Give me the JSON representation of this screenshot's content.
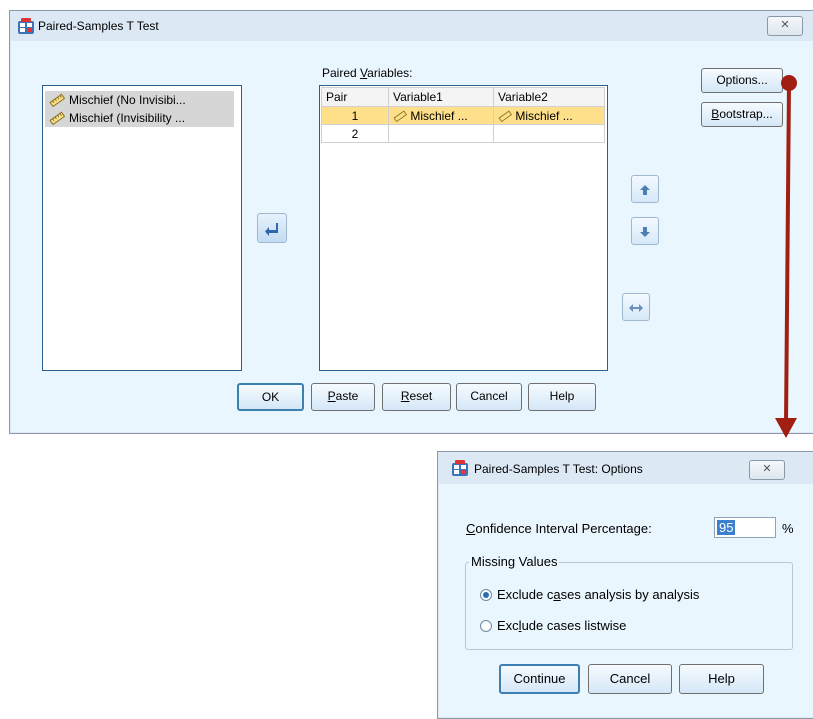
{
  "main_dialog": {
    "title": "Paired-Samples T Test",
    "close_glyph": "✕",
    "source_list": [
      "Mischief (No Invisibi...",
      "Mischief (Invisibility ..."
    ],
    "paired_label_pre": "Paired ",
    "paired_label_ul": "V",
    "paired_label_post": "ariables:",
    "table": {
      "headers": [
        "Pair",
        "Variable1",
        "Variable2"
      ],
      "rows": [
        {
          "pair": "1",
          "v1": "Mischief ...",
          "v2": "Mischief ..."
        },
        {
          "pair": "2",
          "v1": "",
          "v2": ""
        }
      ]
    },
    "options_button": "Options...",
    "bootstrap_ul": "B",
    "bootstrap_rest": "ootstrap...",
    "ok": "OK",
    "paste_ul": "P",
    "paste_rest": "aste",
    "reset_ul": "R",
    "reset_rest": "eset",
    "cancel": "Cancel",
    "help": "Help",
    "move_glyph": "➜",
    "up_glyph": "🡡",
    "down_glyph": "🡣",
    "swap_glyph": "↔"
  },
  "options_dialog": {
    "title": "Paired-Samples T Test: Options",
    "close_glyph": "✕",
    "ci_label_ul": "C",
    "ci_label_rest": "onfidence Interval Percentage:",
    "ci_value": "95",
    "ci_unit": "%",
    "missing_legend": "Missing Values",
    "radio1_pre": "Exclude c",
    "radio1_ul": "a",
    "radio1_post": "ses analysis by analysis",
    "radio2_pre": "Exc",
    "radio2_ul": "l",
    "radio2_post": "ude cases listwise",
    "continue": "Continue",
    "cancel": "Cancel",
    "help": "Help"
  },
  "colors": {
    "dialog_bg": "#eaf6fd",
    "selection": "#ffe08a",
    "arrow": "#9b1b12"
  }
}
